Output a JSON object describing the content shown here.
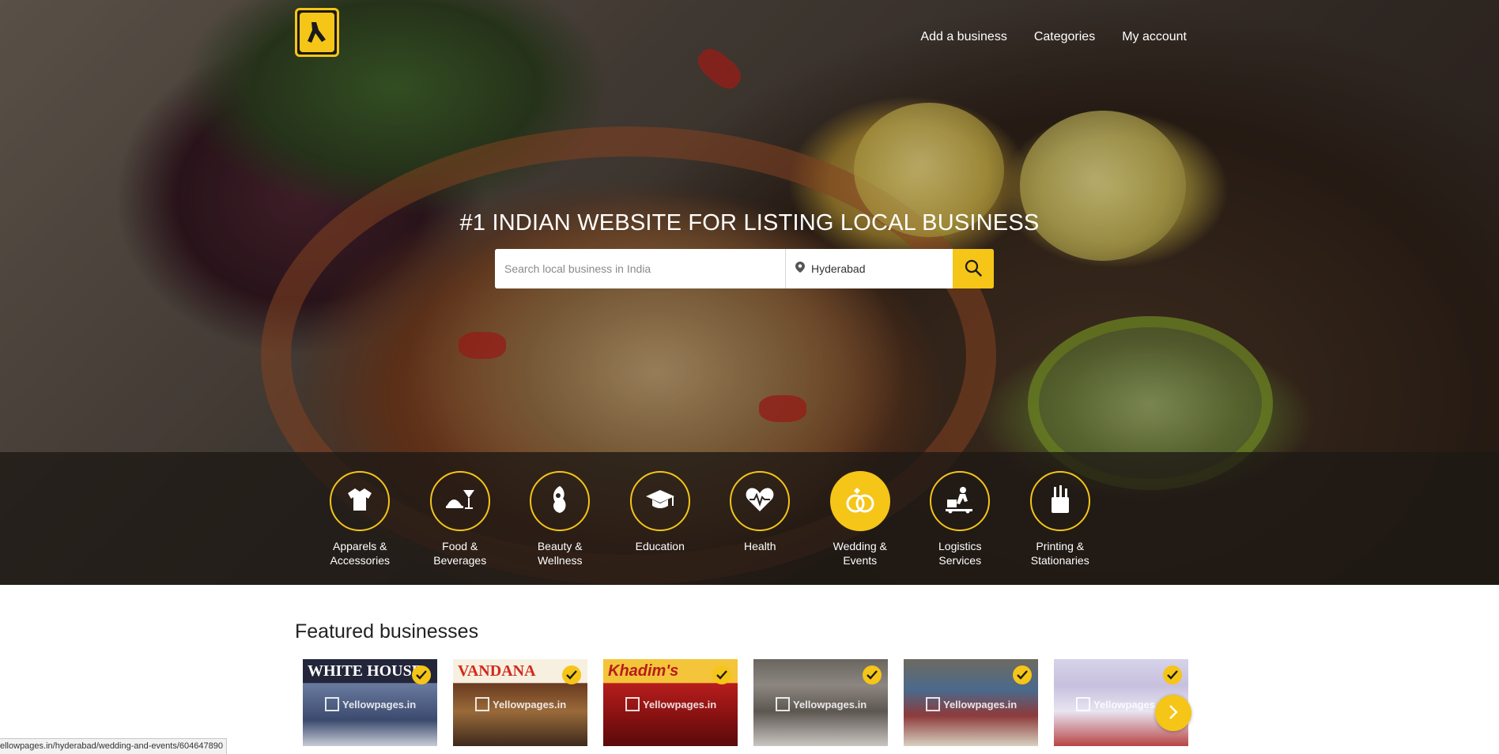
{
  "nav": {
    "logo": "yellowpages-logo",
    "links": [
      "Add a business",
      "Categories",
      "My account"
    ]
  },
  "hero": {
    "tagline": "#1 INDIAN WEBSITE FOR LISTING LOCAL BUSINESS",
    "search_placeholder": "Search local business in India",
    "location_value": "Hyderabad",
    "search_icon": "search-icon",
    "location_icon": "map-pin-icon"
  },
  "categories": [
    {
      "label": "Apparels & Accessories",
      "icon": "shirt-icon",
      "active": false
    },
    {
      "label": "Food & Beverages",
      "icon": "food-drink-icon",
      "active": false
    },
    {
      "label": "Beauty & Wellness",
      "icon": "beauty-icon",
      "active": false
    },
    {
      "label": "Education",
      "icon": "graduation-cap-icon",
      "active": false
    },
    {
      "label": "Health",
      "icon": "heart-pulse-icon",
      "active": false
    },
    {
      "label": "Wedding & Events",
      "icon": "rings-icon",
      "active": true
    },
    {
      "label": "Logistics Services",
      "icon": "delivery-icon",
      "active": false
    },
    {
      "label": "Printing & Stationaries",
      "icon": "pen-holder-icon",
      "active": false
    }
  ],
  "featured": {
    "title": "Featured businesses",
    "watermark": "Yellowpages.in",
    "cards": [
      {
        "sign": "WHITE HOUSE"
      },
      {
        "sign": "VANDANA"
      },
      {
        "sign": "Khadim's"
      },
      {
        "sign": ""
      },
      {
        "sign": ""
      },
      {
        "sign": ""
      }
    ]
  },
  "status_bar": {
    "url": "ellowpages.in/hyderabad/wedding-and-events/604647890"
  },
  "colors": {
    "accent": "#f5c518",
    "strip": "#1e1814"
  }
}
